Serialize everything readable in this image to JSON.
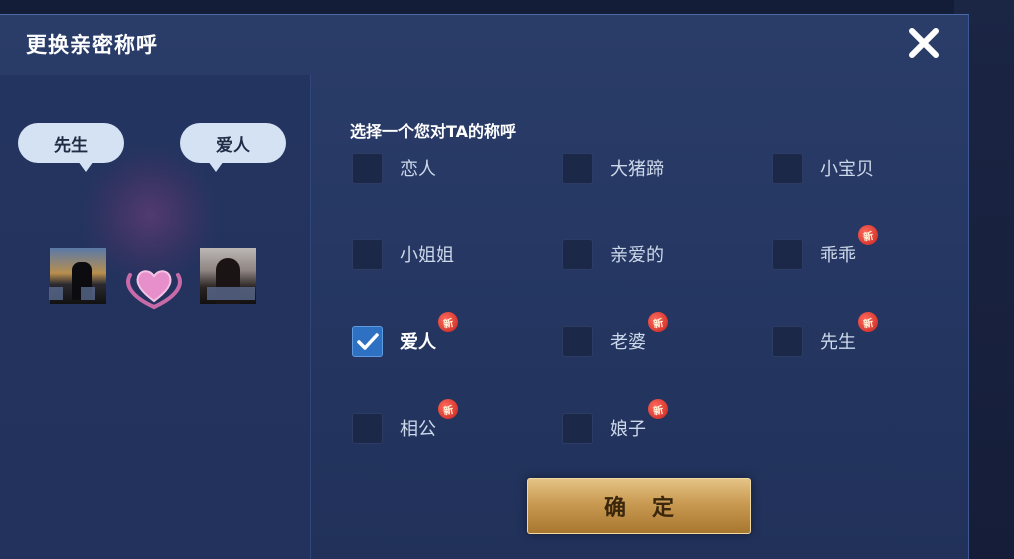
{
  "dialog": {
    "title": "更换亲密称呼",
    "close_icon": "close-x-icon",
    "confirm_label": "确定"
  },
  "left_panel": {
    "bubble_left": "先生",
    "bubble_right": "爱人",
    "heart_icon": "double-heart-icon"
  },
  "selection": {
    "prompt": "选择一个您对TA的称呼",
    "new_badge": "新",
    "options": [
      {
        "label": "恋人",
        "checked": false,
        "new": false
      },
      {
        "label": "大猪蹄",
        "checked": false,
        "new": false
      },
      {
        "label": "小宝贝",
        "checked": false,
        "new": false
      },
      {
        "label": "小姐姐",
        "checked": false,
        "new": false
      },
      {
        "label": "亲爱的",
        "checked": false,
        "new": false
      },
      {
        "label": "乖乖",
        "checked": false,
        "new": true
      },
      {
        "label": "爱人",
        "checked": true,
        "new": true
      },
      {
        "label": "老婆",
        "checked": false,
        "new": true
      },
      {
        "label": "先生",
        "checked": false,
        "new": true
      },
      {
        "label": "相公",
        "checked": false,
        "new": true
      },
      {
        "label": "娘子",
        "checked": false,
        "new": true
      }
    ]
  },
  "colors": {
    "accent_gold": "#c99a52",
    "checkbox_checked": "#2e71c3",
    "new_badge": "#c5231c"
  }
}
